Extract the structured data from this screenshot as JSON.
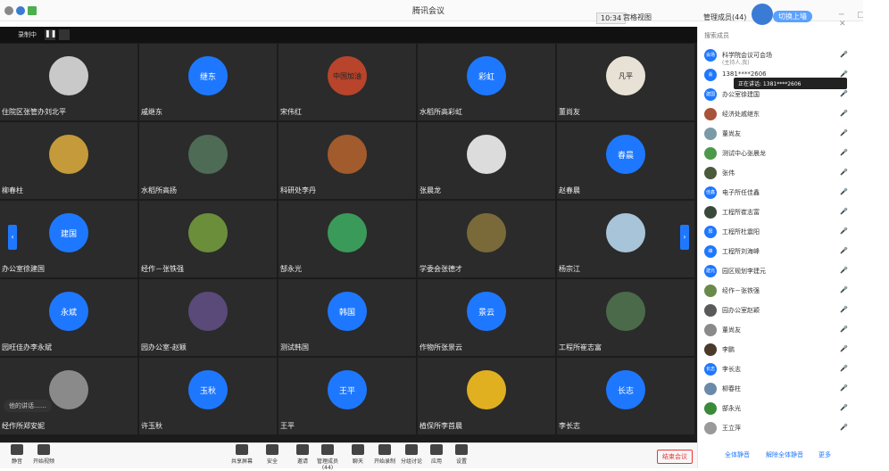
{
  "app_title": "腾讯会议",
  "top": {
    "timer": "10:34",
    "view_label": "宫格视图",
    "participants_label": "管理成员(44)",
    "logo_button": "切换上墙"
  },
  "recording": {
    "label": "录制中"
  },
  "tiles": [
    {
      "name": "住院区张管办刘北平",
      "avatar": "",
      "kind": "img",
      "color": "#c9c9c9"
    },
    {
      "name": "戚继东",
      "avatar": "继东",
      "kind": "blue"
    },
    {
      "name": "宋伟红",
      "avatar": "中国加油",
      "kind": "img",
      "color": "#b8442c"
    },
    {
      "name": "水稻所高彩虹",
      "avatar": "彩虹",
      "kind": "blue"
    },
    {
      "name": "董尚友",
      "avatar": "凡平",
      "kind": "img",
      "color": "#e8e2d6"
    },
    {
      "name": "柳春柱",
      "avatar": "",
      "kind": "img",
      "color": "#c49a3a"
    },
    {
      "name": "水稻所高扬",
      "avatar": "",
      "kind": "img",
      "color": "#4e6b55"
    },
    {
      "name": "科研处李丹",
      "avatar": "",
      "kind": "img",
      "color": "#a25b2d"
    },
    {
      "name": "张晨龙",
      "avatar": "",
      "kind": "img",
      "color": "#dcdcdc"
    },
    {
      "name": "赵春晨",
      "avatar": "春晨",
      "kind": "blue"
    },
    {
      "name": "办公室徐建国",
      "avatar": "建国",
      "kind": "blue"
    },
    {
      "name": "经作－张铁强",
      "avatar": "",
      "kind": "img",
      "color": "#6b8e3a"
    },
    {
      "name": "郜永光",
      "avatar": "",
      "kind": "img",
      "color": "#3a9a5a"
    },
    {
      "name": "学委会张德才",
      "avatar": "",
      "kind": "img",
      "color": "#7a6a3a"
    },
    {
      "name": "杨宗江",
      "avatar": "",
      "kind": "img",
      "color": "#a7c4d9"
    },
    {
      "name": "园旺佳办李永斌",
      "avatar": "永斌",
      "kind": "blue"
    },
    {
      "name": "园办公室-赵颖",
      "avatar": "",
      "kind": "img",
      "color": "#5a4a7a"
    },
    {
      "name": "测试韩国",
      "avatar": "韩国",
      "kind": "blue"
    },
    {
      "name": "作物所张景云",
      "avatar": "景云",
      "kind": "blue"
    },
    {
      "name": "工程所崔志富",
      "avatar": "",
      "kind": "img",
      "color": "#4a6a4a"
    },
    {
      "name": "经作所郑安妮",
      "avatar": "",
      "kind": "img",
      "color": "#8a8a8a"
    },
    {
      "name": "许玉秋",
      "avatar": "玉秋",
      "kind": "blue"
    },
    {
      "name": "王平",
      "avatar": "王平",
      "kind": "blue"
    },
    {
      "name": "植保所李首晨",
      "avatar": "",
      "kind": "img",
      "color": "#e0b020"
    },
    {
      "name": "李长志",
      "avatar": "长志",
      "kind": "blue"
    }
  ],
  "notification": "他的讲话……",
  "toolbar": {
    "items": [
      "静音",
      "开始视频",
      "共享屏幕",
      "安全",
      "邀请",
      "管理成员(44)",
      "聊天",
      "开始录制",
      "分组讨论",
      "应用",
      "设置"
    ],
    "end": "结束会议"
  },
  "panel": {
    "search_placeholder": "搜索成员",
    "tooltip": "正在讲话: 1381****2606",
    "members": [
      {
        "name": "科学院会议可会场",
        "sub": "(主持人,我)",
        "blue": true,
        "av": "会场"
      },
      {
        "name": "1381****2606",
        "blue": true,
        "av": "会"
      },
      {
        "name": "办公室徐建国",
        "blue": true,
        "av": "建国"
      },
      {
        "name": "经济处戚继东",
        "blue": false,
        "color": "#a8543a"
      },
      {
        "name": "董尚友",
        "blue": false,
        "color": "#7a9aa8"
      },
      {
        "name": "测试中心张晨龙",
        "blue": false,
        "color": "#4a9a4a"
      },
      {
        "name": "张伟",
        "blue": false,
        "color": "#4a5a3a"
      },
      {
        "name": "电子所任佳鑫",
        "blue": true,
        "av": "佳鑫"
      },
      {
        "name": "工程所崔志富",
        "blue": false,
        "color": "#3a4a3a"
      },
      {
        "name": "工程所杜震阳",
        "blue": true,
        "av": "阳"
      },
      {
        "name": "工程所刘海峰",
        "blue": true,
        "av": "峰"
      },
      {
        "name": "园区规划李建元",
        "blue": true,
        "av": "建元"
      },
      {
        "name": "经作－张铁强",
        "blue": false,
        "color": "#6a8a4a"
      },
      {
        "name": "园办公室赵颖",
        "blue": false,
        "color": "#5a5a5a"
      },
      {
        "name": "董尚友",
        "blue": false,
        "color": "#8a8a8a"
      },
      {
        "name": "李鹏",
        "blue": false,
        "color": "#4a3a2a"
      },
      {
        "name": "李长志",
        "blue": true,
        "av": "长志"
      },
      {
        "name": "柳春柱",
        "blue": false,
        "color": "#6a8aa8"
      },
      {
        "name": "郜永光",
        "blue": false,
        "color": "#3a8a3a"
      },
      {
        "name": "王立萍",
        "blue": false,
        "color": "#9a9a9a"
      }
    ],
    "footer": [
      "全体静音",
      "解除全体静音",
      "更多"
    ]
  }
}
